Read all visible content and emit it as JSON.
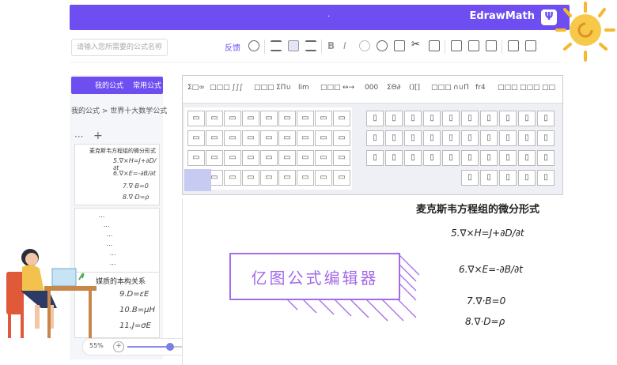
{
  "app": {
    "title": "EdrawMath",
    "logo": "Ψ",
    "dot": "·"
  },
  "toolbar": {
    "search_placeholder": "请输入您所需要的公式名称",
    "feedback_label": "反馈",
    "icons": [
      "settings-icon",
      "align-left-icon",
      "align-center-icon",
      "align-right-icon",
      "bold-icon",
      "italic-icon",
      "undo-icon",
      "redo-icon",
      "copy-icon",
      "cut-icon",
      "paste-icon",
      "export-icon",
      "image-icon",
      "export2-icon",
      "add-icon",
      "new-page-icon"
    ]
  },
  "sidebar": {
    "tabs": [
      "常用公式",
      "我的公式"
    ],
    "breadcrumb": "我的公式 > 世界十大数学公式",
    "more": "···",
    "add": "+",
    "card1": {
      "title": "麦克斯韦方程组的微分形式",
      "lines": [
        "5.∇×H=J+∂D/∂t",
        "6.∇×E=-∂B/∂t",
        "7.∇·B=0",
        "8.∇·D=ρ"
      ]
    },
    "card2": {
      "lines": [
        "...",
        "...",
        "...",
        "...",
        "...",
        "..."
      ]
    },
    "card3": {
      "title": "媒质的本构关系",
      "lines": [
        "9.D=εE",
        "10.B=μH",
        "11.J=σE"
      ]
    }
  },
  "zoom": {
    "value": "55%",
    "minus": "−",
    "plus": "+",
    "level": 0.75
  },
  "symbols": {
    "tabs": [
      "Σ□∞",
      "□□□",
      "∫∫∫",
      "□□□",
      "ΣΠ∪",
      "lim",
      "□□□",
      "↔→",
      "000",
      "ΣΘ∂",
      "()[]",
      "□□□",
      "∩∪Π",
      "fr4",
      "□□□",
      "□□□",
      "□□"
    ]
  },
  "canvas": {
    "title": "麦克斯韦方程组的微分形式",
    "equations": [
      "5.∇×H=J+∂D/∂t",
      "6.∇×E=-∂B/∂t",
      "7.∇·B=0",
      "8.∇·D=ρ"
    ],
    "banner": "亿图公式编辑器"
  },
  "colors": {
    "accent": "#6e4ef0",
    "banner": "#a36be8"
  }
}
